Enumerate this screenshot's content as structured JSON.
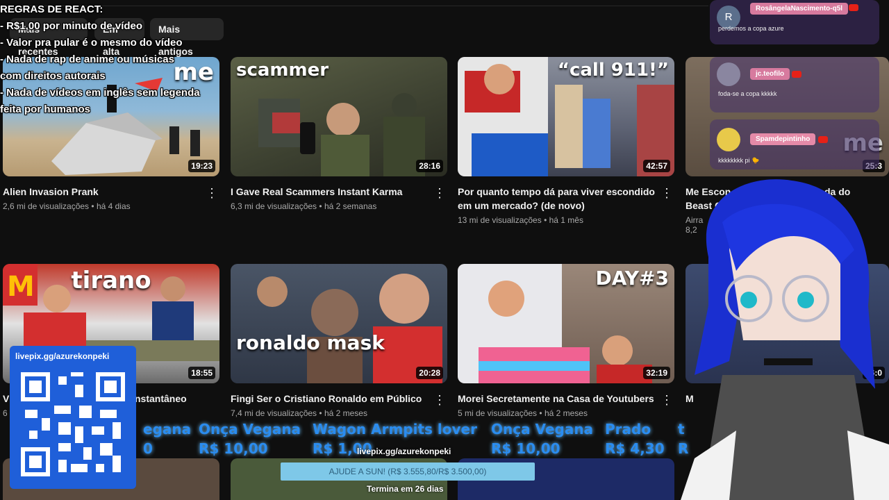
{
  "chips": [
    "Mais recentes",
    "Em alta",
    "Mais antigos"
  ],
  "rules": {
    "heading": "REGRAS DE REACT:",
    "lines": [
      "- R$1,00 por minuto de vídeo",
      "- Valor pra pular é o mesmo do vídeo",
      "- Nada de rap de anime ou músicas",
      "com direitos autorais",
      "- Nada de vídeos em inglês sem legenda",
      "feita por humanos"
    ]
  },
  "videos": [
    {
      "title": "Alien Invasion Prank",
      "views": "2,6 mi de visualizações",
      "age": "há 4 dias",
      "duration": "19:23",
      "overlay": "me",
      "thumb_bg": "#5c8fb5"
    },
    {
      "title": "I Gave Real Scammers Instant Karma",
      "views": "6,3 mi de visualizações",
      "age": "há 2 semanas",
      "duration": "28:16",
      "overlay": "scammer",
      "thumb_bg": "#4a4f3a"
    },
    {
      "title": "Por quanto tempo dá para viver escondido em um mercado? (de novo)",
      "views": "13 mi de visualizações",
      "age": "há 1 mês",
      "duration": "42:57",
      "overlay": "“call 911!”",
      "thumb_bg": "#6a6f84"
    },
    {
      "title": "Me Escon",
      "title_tail": "da do",
      "title2": "Beast G",
      "views": "Airra",
      "age": "8,2",
      "duration": "25:3",
      "overlay": "me",
      "thumb_bg": "#6a5c50"
    },
    {
      "title": "V",
      "title_tail": "nstantâneo",
      "views": "6",
      "age": "",
      "duration": "18:55",
      "overlay": "tirano",
      "thumb_bg": "#a34a2c"
    },
    {
      "title": "Fingi Ser o Cristiano Ronaldo em Público",
      "views": "7,4 mi de visualizações",
      "age": "há 2 meses",
      "duration": "20:28",
      "overlay": "ronaldo mask",
      "thumb_bg": "#3f4a58"
    },
    {
      "title": "Morei Secretamente na Casa de Youtubers",
      "views": "5 mi de visualizações",
      "age": "há 2 meses",
      "duration": "32:19",
      "overlay": "DAY#3",
      "thumb_bg": "#8d7a6e"
    },
    {
      "title": "M",
      "views": "",
      "age": "",
      "duration": "26:0",
      "overlay": "",
      "thumb_bg": "#3d4b6e"
    }
  ],
  "chat": [
    {
      "initial": "R",
      "name": "RosângelaNascimento-q5l",
      "text": "perdemos a copa azure"
    },
    {
      "initial": "",
      "name": "jc.teofilo",
      "text": "foda-se a copa kkkkk"
    },
    {
      "initial": "",
      "name": "Spamdepintinho",
      "text": "kkkkkkkk pi 🐤"
    }
  ],
  "qr": {
    "label": "livepix.gg/azurekonpeki"
  },
  "donations": [
    {
      "name": "egana",
      "amount": "0"
    },
    {
      "name": "Onça Vegana",
      "amount": "R$ 10,00"
    },
    {
      "name": "Wagon Armpits lover",
      "amount": "R$ 1,00"
    },
    {
      "name": "Onça Vegana",
      "amount": "R$ 10,00"
    },
    {
      "name": "Prado",
      "amount": "R$ 4,30"
    },
    {
      "name": "t",
      "amount": "R"
    }
  ],
  "livepix_url": "livepix.gg/azurekonpeki",
  "goal": {
    "text": "AJUDE A SUN! (R$ 3.555,80/R$ 3.500,00)",
    "ends": "Termina em 26 dias"
  },
  "colors": {
    "bg": "#0f0f0f",
    "chip": "#272727",
    "meta": "#aaaaaa",
    "ticker": "#2a8cf0",
    "qr": "#1f5fd9"
  }
}
